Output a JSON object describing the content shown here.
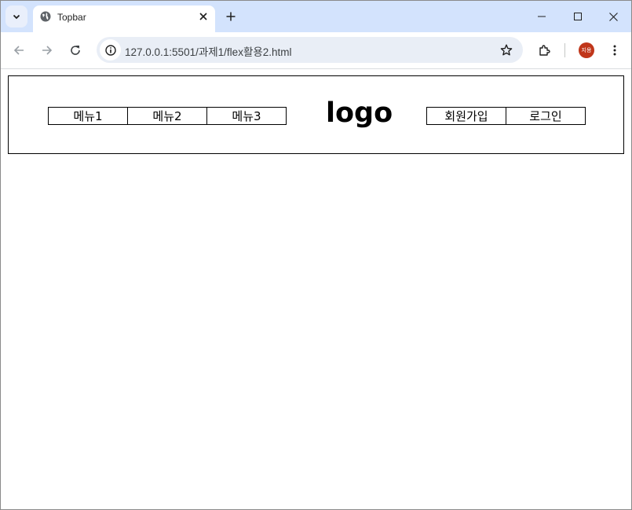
{
  "browser": {
    "tab": {
      "title": "Topbar"
    },
    "address": {
      "url": "127.0.0.1:5501/과제1/flex활용2.html"
    },
    "profile": {
      "initials": "지용"
    }
  },
  "page": {
    "menus": [
      "메뉴1",
      "메뉴2",
      "메뉴3"
    ],
    "logo": "logo",
    "auth": [
      "회원가입",
      "로그인"
    ]
  }
}
